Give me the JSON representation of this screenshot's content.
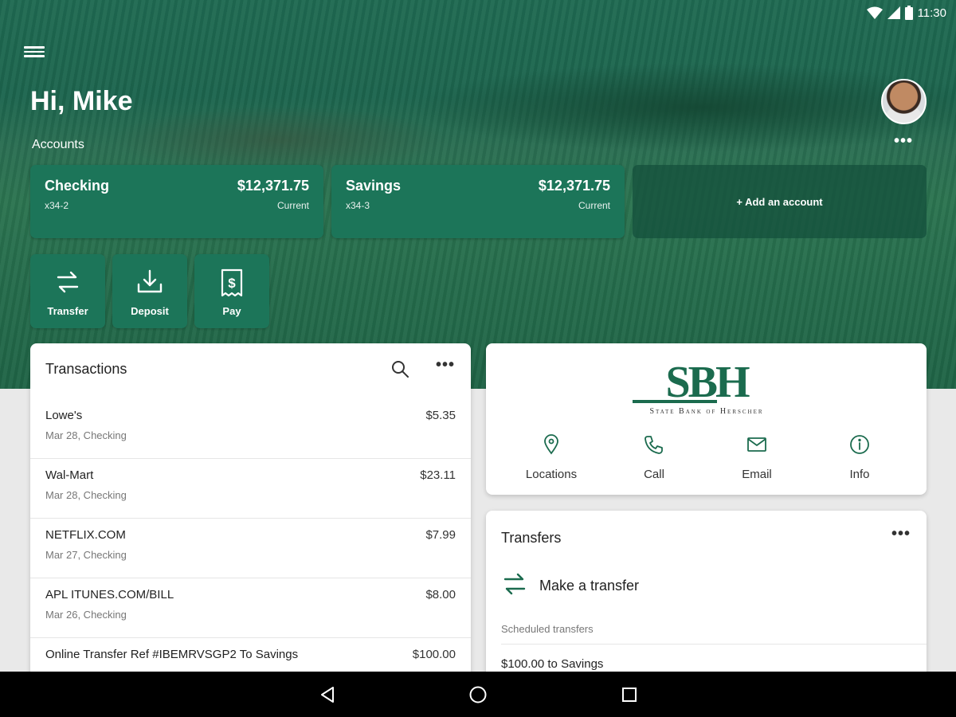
{
  "status_bar": {
    "time": "11:30"
  },
  "header": {
    "greeting": "Hi, Mike",
    "accounts_label": "Accounts",
    "accounts_more": "•••"
  },
  "accounts": [
    {
      "name": "Checking",
      "number": "x34-2",
      "balance": "$12,371.75",
      "balance_label": "Current"
    },
    {
      "name": "Savings",
      "number": "x34-3",
      "balance": "$12,371.75",
      "balance_label": "Current"
    }
  ],
  "add_account": "+ Add an account",
  "actions": [
    {
      "label": "Transfer",
      "icon": "transfer-icon"
    },
    {
      "label": "Deposit",
      "icon": "deposit-icon"
    },
    {
      "label": "Pay",
      "icon": "pay-icon"
    }
  ],
  "transactions": {
    "title": "Transactions",
    "more": "•••",
    "rows": [
      {
        "merchant": "Lowe's",
        "meta": "Mar 28, Checking",
        "amount": "$5.35"
      },
      {
        "merchant": "Wal-Mart",
        "meta": "Mar 28, Checking",
        "amount": "$23.11"
      },
      {
        "merchant": "NETFLIX.COM",
        "meta": "Mar 27, Checking",
        "amount": "$7.99"
      },
      {
        "merchant": "APL ITUNES.COM/BILL",
        "meta": "Mar 26, Checking",
        "amount": "$8.00"
      },
      {
        "merchant": "Online Transfer Ref #IBEMRVSGP2 To Savings",
        "meta": "",
        "amount": "$100.00"
      }
    ]
  },
  "bank": {
    "logo_letters": "SBH",
    "logo_subtitle": "State Bank of Herscher",
    "contacts": [
      {
        "label": "Locations",
        "icon": "location-pin-icon"
      },
      {
        "label": "Call",
        "icon": "phone-icon"
      },
      {
        "label": "Email",
        "icon": "email-icon"
      },
      {
        "label": "Info",
        "icon": "info-icon"
      }
    ]
  },
  "transfers": {
    "title": "Transfers",
    "more": "•••",
    "make_transfer": "Make a transfer",
    "scheduled_label": "Scheduled transfers",
    "scheduled": [
      "$100.00 to Savings"
    ]
  },
  "colors": {
    "brand_green": "#1c7559",
    "logo_green": "#1b6b4e",
    "panel_bg": "#ffffff",
    "page_bg": "#e9e9e9"
  }
}
